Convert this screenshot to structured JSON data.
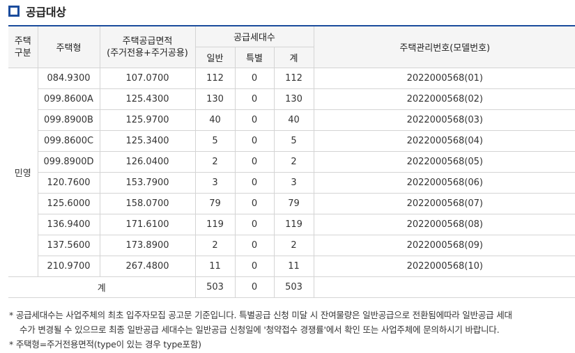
{
  "section": {
    "title": "공급대상"
  },
  "table": {
    "header": {
      "gubun_line1": "주택",
      "gubun_line2": "구분",
      "type": "주택형",
      "area_line1": "주택공급면적",
      "area_line2": "(주거전용+주거공용)",
      "units": "공급세대수",
      "general": "일반",
      "special": "특별",
      "total": "계",
      "mgmt": "주택관리번호(모델번호)"
    },
    "gubun": "민영",
    "rows": [
      {
        "type": "084.9300",
        "area": "107.0700",
        "general": "112",
        "special": "0",
        "total": "112",
        "mgmt": "2022000568(01)"
      },
      {
        "type": "099.8600A",
        "area": "125.4300",
        "general": "130",
        "special": "0",
        "total": "130",
        "mgmt": "2022000568(02)"
      },
      {
        "type": "099.8900B",
        "area": "125.9700",
        "general": "40",
        "special": "0",
        "total": "40",
        "mgmt": "2022000568(03)"
      },
      {
        "type": "099.8600C",
        "area": "125.3400",
        "general": "5",
        "special": "0",
        "total": "5",
        "mgmt": "2022000568(04)"
      },
      {
        "type": "099.8900D",
        "area": "126.0400",
        "general": "2",
        "special": "0",
        "total": "2",
        "mgmt": "2022000568(05)"
      },
      {
        "type": "120.7600",
        "area": "153.7900",
        "general": "3",
        "special": "0",
        "total": "3",
        "mgmt": "2022000568(06)"
      },
      {
        "type": "125.6000",
        "area": "158.0700",
        "general": "79",
        "special": "0",
        "total": "79",
        "mgmt": "2022000568(07)"
      },
      {
        "type": "136.9400",
        "area": "171.6100",
        "general": "119",
        "special": "0",
        "total": "119",
        "mgmt": "2022000568(08)"
      },
      {
        "type": "137.5600",
        "area": "173.8900",
        "general": "2",
        "special": "0",
        "total": "2",
        "mgmt": "2022000568(09)"
      },
      {
        "type": "210.9700",
        "area": "267.4800",
        "general": "11",
        "special": "0",
        "total": "11",
        "mgmt": "2022000568(10)"
      }
    ],
    "total_row": {
      "label": "계",
      "general": "503",
      "special": "0",
      "total": "503"
    }
  },
  "notes": {
    "note1_line1": "* 공급세대수는 사업주체의 최초 입주자모집 공고문 기준입니다. 특별공급 신청 미달 시 잔여물량은 일반공급으로 전환됨에따라 일반공급 세대",
    "note1_line2": "수가 변경될 수 있으므로 최종 일반공급 세대수는 일반공급 신청일에 '청약접수 경쟁률'에서 확인 또는 사업주체에 문의하시기 바랍니다.",
    "note2": "* 주택형=주거전용면적(type이 있는 경우 type포함)"
  }
}
